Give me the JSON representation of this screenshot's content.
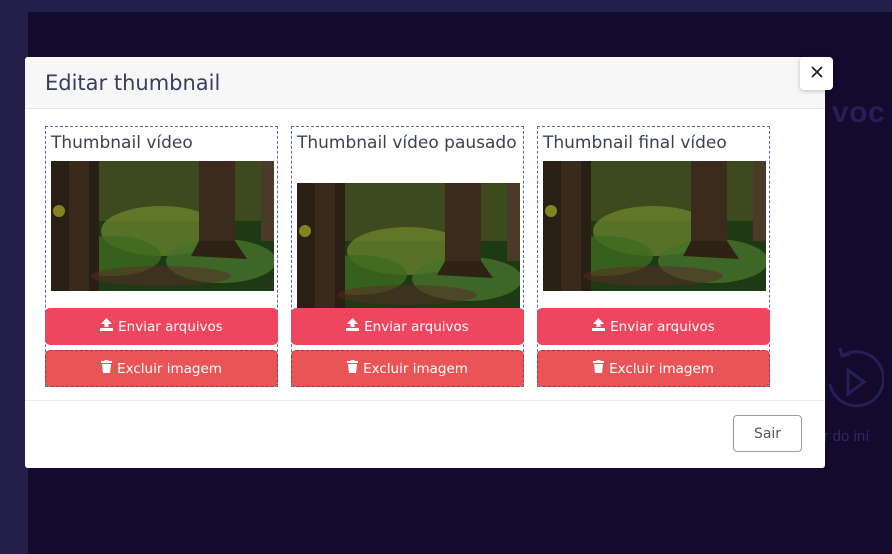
{
  "modal": {
    "title": "Editar thumbnail",
    "close_icon": "close-icon",
    "exit_label": "Sair"
  },
  "cards": [
    {
      "title": "Thumbnail vídeo",
      "upload_label": "Enviar arquivos",
      "delete_label": "Excluir imagem"
    },
    {
      "title": "Thumbnail vídeo pausado",
      "upload_label": "Enviar arquivos",
      "delete_label": "Excluir imagem"
    },
    {
      "title": "Thumbnail final vídeo",
      "upload_label": "Enviar arquivos",
      "delete_label": "Excluir imagem"
    }
  ],
  "background": {
    "partial_heading": "voc",
    "partial_caption": "tir do iní"
  },
  "colors": {
    "upload_button": "#ef4660",
    "delete_button": "#ea5456",
    "dashed_border": "#5a6ab0",
    "backdrop": "#130a2e"
  },
  "icons": {
    "upload": "upload-icon",
    "delete": "trash-icon",
    "replay": "replay-icon"
  }
}
